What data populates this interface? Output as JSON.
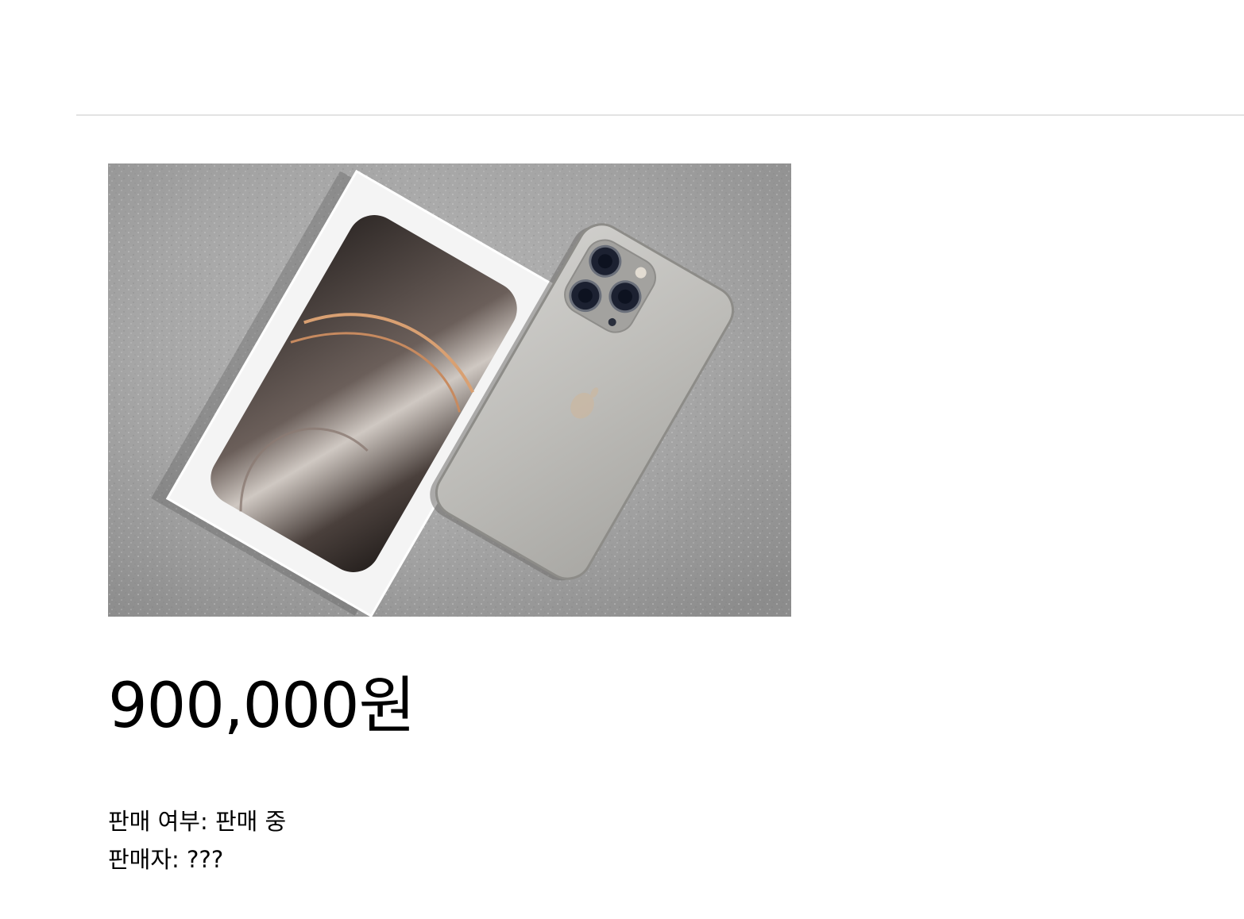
{
  "product": {
    "image_alt": "phone product photo",
    "price": "900,000원",
    "sale_status_label": "판매 여부: ",
    "sale_status_value": "판매 중",
    "seller_label": "판매자: ",
    "seller_value": "???"
  },
  "colors": {
    "divider": "#e3e3e3",
    "text": "#000000",
    "background": "#ffffff"
  }
}
